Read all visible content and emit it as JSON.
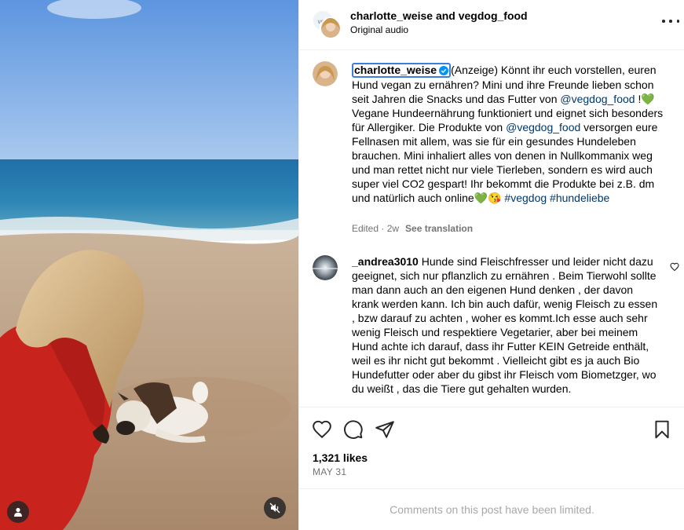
{
  "header": {
    "title": "charlotte_weise and vegdog_food",
    "audio": "Original audio",
    "more_icon": "more-horizontal-icon"
  },
  "caption": {
    "username": "charlotte_weise",
    "verified_icon": "verified-badge-icon",
    "text_1": "(Anzeige) Könnt ihr euch vorstellen, euren Hund vegan zu ernähren? Mini und ihre Freunde lieben schon seit Jahren die Snacks und das Futter von ",
    "mention_1": "@vegdog_food",
    "text_2": " !💚 Vegane Hundeernährung funktioniert und eignet sich besonders für Allergiker. Die Produkte von ",
    "mention_2": "@vegdog_food",
    "text_3": " versorgen eure Fellnasen mit allem, was sie für ein gesundes Hundeleben brauchen. Mini inhaliert alles von denen in Nullkommanix weg und man rettet nicht nur viele Tierleben, sondern es wird auch super viel CO2 gespart! Ihr bekommt die Produkte bei z.B. dm und natürlich auch online💚😘 ",
    "hashtag_1": "#vegdog",
    "hashtag_2": "#hundeliebe",
    "edited": "Edited · 2w",
    "see_translation": "See translation"
  },
  "comments": [
    {
      "username": "_andrea3010",
      "text": " Hunde sind Fleischfresser und leider nicht dazu geeignet, sich nur pflanzlich zu ernähren . Beim Tierwohl sollte man dann auch an den eigenen Hund denken , der davon krank werden kann. Ich bin auch dafür, wenig Fleisch zu essen , bzw darauf zu achten , woher es kommt.Ich esse auch sehr wenig Fleisch und respektiere Vegetarier, aber bei meinem Hund achte ich darauf, dass ihr Futter KEIN Getreide enthält, weil es ihr nicht gut bekommt . Vielleicht gibt es ja auch Bio Hundefutter oder aber du gibst ihr Fleisch vom Biometzger, wo du weißt , das die Tiere gut gehalten wurden."
    }
  ],
  "actions": {
    "like_icon": "heart-icon",
    "comment_icon": "comment-icon",
    "share_icon": "share-icon",
    "save_icon": "bookmark-icon"
  },
  "likes": "1,321 likes",
  "date": "MAY 31",
  "comments_limited": "Comments on this post have been limited.",
  "colors": {
    "link": "#00376b",
    "secondary": "#737373",
    "verified": "#0095f6",
    "highlight_border": "#3b7ee0"
  }
}
